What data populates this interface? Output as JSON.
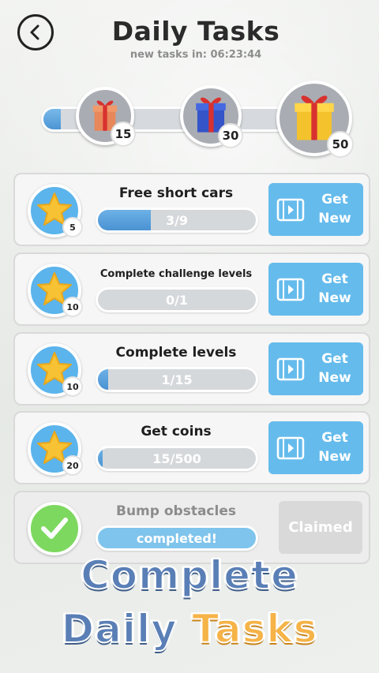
{
  "header": {
    "title": "Daily Tasks",
    "timer_text": "new tasks in: 06:23:44"
  },
  "progress": {
    "fill_fraction": 0.06,
    "chests": [
      {
        "count": "15",
        "colors": {
          "box": "#e8875a",
          "ribbon": "#d8322f"
        }
      },
      {
        "count": "30",
        "colors": {
          "box": "#3554c8",
          "ribbon": "#d8322f"
        }
      },
      {
        "count": "50",
        "colors": {
          "box": "#f4c22d",
          "ribbon": "#d8322f"
        }
      }
    ]
  },
  "tasks": [
    {
      "name": "Free short cars",
      "reward": "5",
      "progress_text": "3/9",
      "progress_fraction": 0.333,
      "button_label": "Get New"
    },
    {
      "name": "Complete challenge levels",
      "reward": "10",
      "progress_text": "0/1",
      "progress_fraction": 0.0,
      "button_label": "Get New"
    },
    {
      "name": "Complete levels",
      "reward": "10",
      "progress_text": "1/15",
      "progress_fraction": 0.067,
      "button_label": "Get New"
    },
    {
      "name": "Get coins",
      "reward": "20",
      "progress_text": "15/500",
      "progress_fraction": 0.03,
      "button_label": "Get New"
    },
    {
      "name": "Bump obstacles",
      "progress_text": "completed!",
      "progress_fraction": 1.0,
      "button_label": "Claimed"
    }
  ],
  "promo": {
    "line1": "Complete",
    "line2_part1": "Daily",
    "line2_part2": "Tasks"
  },
  "colors": {
    "accent_blue": "#65bbec",
    "progress_blue": "#4a92d2",
    "star": "#f7c234",
    "check_green": "#7dd85f",
    "promo_blue": "#5a7fb6",
    "promo_orange": "#f6b347"
  },
  "icons": {
    "back": "chevron-left-icon",
    "reward": "star-icon",
    "done": "checkmark-icon",
    "video": "video-play-icon",
    "chest": "gift-box-icon"
  }
}
